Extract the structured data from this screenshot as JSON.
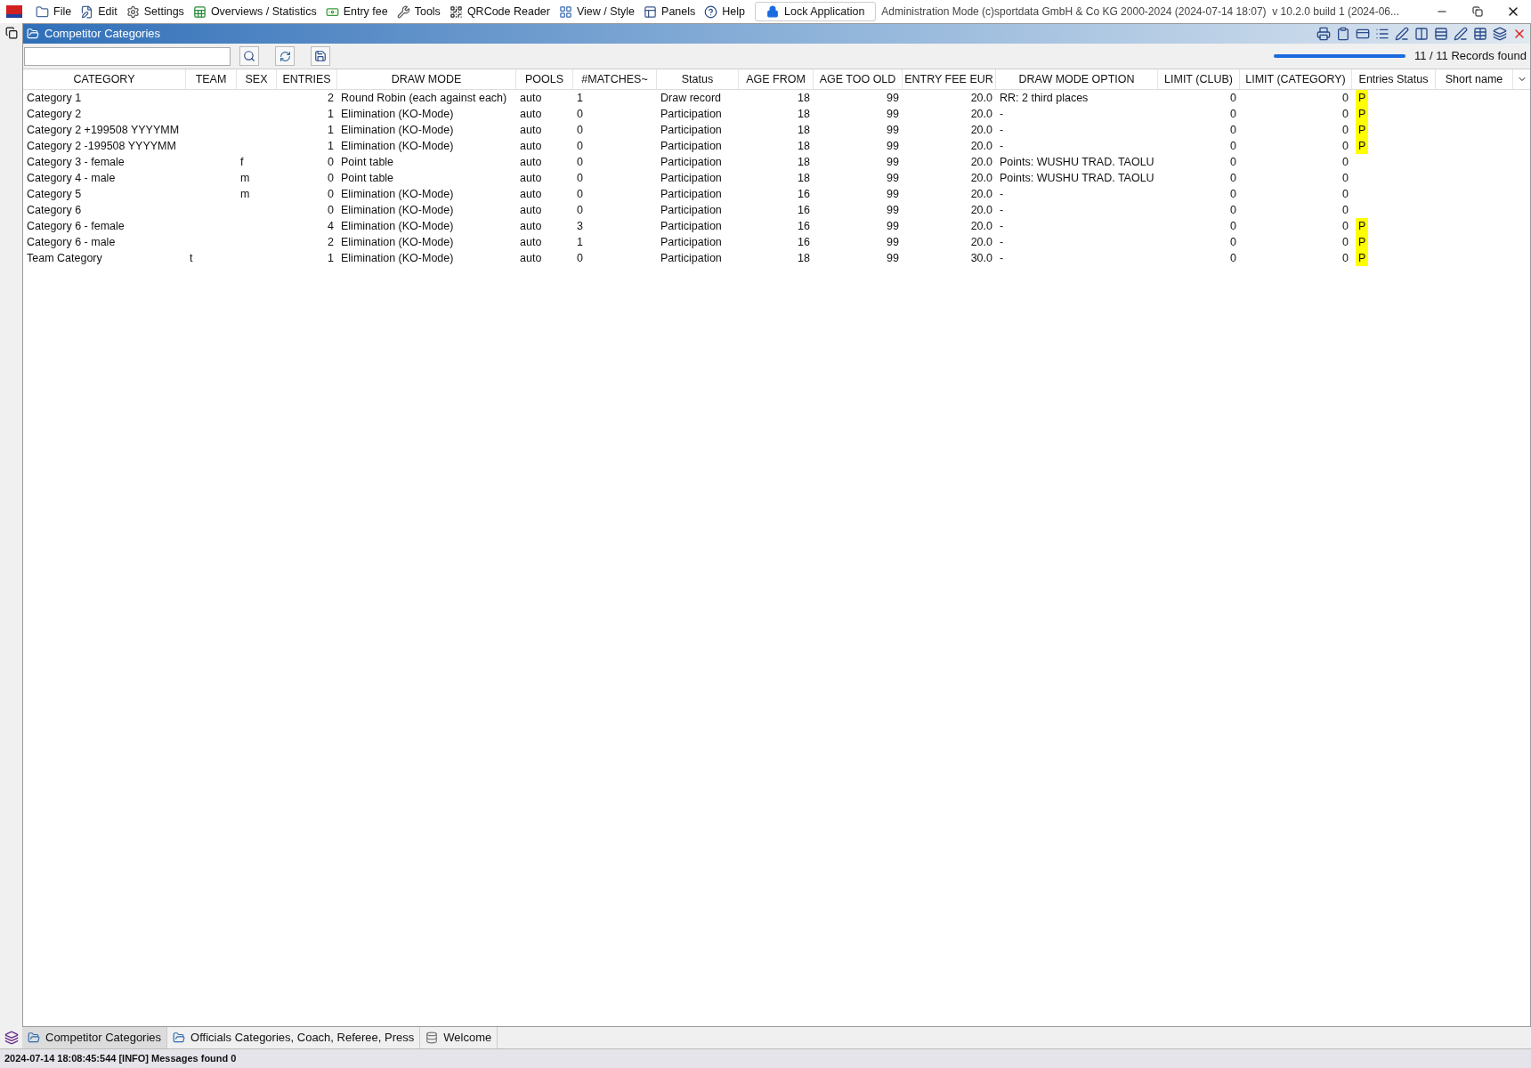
{
  "menu": {
    "items": [
      {
        "label": "File"
      },
      {
        "label": "Edit"
      },
      {
        "label": "Settings"
      },
      {
        "label": "Overviews / Statistics"
      },
      {
        "label": "Entry fee"
      },
      {
        "label": "Tools"
      },
      {
        "label": "QRCode Reader"
      },
      {
        "label": "View / Style"
      },
      {
        "label": "Panels"
      },
      {
        "label": "Help"
      }
    ],
    "lock_button": "Lock Application",
    "title_text": "Administration Mode (c)sportdata GmbH & Co KG 2000-2024 (2024-07-14 18:07)  v 10.2.0 build 1 (2024-06..."
  },
  "panel": {
    "title": "Competitor Categories",
    "progress": {
      "level": 1.0
    },
    "records_found": "11 / 11 Records found"
  },
  "table": {
    "columns": [
      "CATEGORY",
      "TEAM",
      "SEX",
      "ENTRIES",
      "DRAW MODE",
      "POOLS",
      "#MATCHES~",
      "Status",
      "AGE FROM",
      "AGE TOO OLD",
      "ENTRY FEE EUR",
      "DRAW MODE OPTION",
      "LIMIT (CLUB)",
      "LIMIT (CATEGORY)",
      "Entries Status",
      "Short name"
    ],
    "rows": [
      {
        "cells": [
          "Category 1",
          "",
          "",
          "2",
          "Round Robin (each against each)",
          "auto",
          "1",
          "Draw record",
          "18",
          "99",
          "20.0",
          "RR: 2 third places",
          "0",
          "0"
        ],
        "entries_status": "P"
      },
      {
        "cells": [
          "Category 2",
          "",
          "",
          "1",
          "Elimination (KO-Mode)",
          "auto",
          "0",
          "Participation",
          "18",
          "99",
          "20.0",
          "-",
          "0",
          "0"
        ],
        "entries_status": "P"
      },
      {
        "cells": [
          "Category 2 +199508 YYYYMM",
          "",
          "",
          "1",
          "Elimination (KO-Mode)",
          "auto",
          "0",
          "Participation",
          "18",
          "99",
          "20.0",
          "-",
          "0",
          "0"
        ],
        "entries_status": "P"
      },
      {
        "cells": [
          "Category 2 -199508 YYYYMM",
          "",
          "",
          "1",
          "Elimination (KO-Mode)",
          "auto",
          "0",
          "Participation",
          "18",
          "99",
          "20.0",
          "-",
          "0",
          "0"
        ],
        "entries_status": "P"
      },
      {
        "cells": [
          "Category 3 - female",
          "",
          "f",
          "0",
          "Point table",
          "auto",
          "0",
          "Participation",
          "18",
          "99",
          "20.0",
          "Points: WUSHU TRAD. TAOLU",
          "0",
          "0"
        ]
      },
      {
        "cells": [
          "Category 4 - male",
          "",
          "m",
          "0",
          "Point table",
          "auto",
          "0",
          "Participation",
          "18",
          "99",
          "20.0",
          "Points: WUSHU TRAD. TAOLU",
          "0",
          "0"
        ]
      },
      {
        "cells": [
          "Category 5",
          "",
          "m",
          "0",
          "Elimination (KO-Mode)",
          "auto",
          "0",
          "Participation",
          "16",
          "99",
          "20.0",
          "-",
          "0",
          "0"
        ]
      },
      {
        "cells": [
          "Category 6",
          "",
          "",
          "0",
          "Elimination (KO-Mode)",
          "auto",
          "0",
          "Participation",
          "16",
          "99",
          "20.0",
          "-",
          "0",
          "0"
        ]
      },
      {
        "cells": [
          "Category 6 - female",
          "",
          "",
          "4",
          "Elimination (KO-Mode)",
          "auto",
          "3",
          "Participation",
          "16",
          "99",
          "20.0",
          "-",
          "0",
          "0"
        ],
        "entries_status": "P"
      },
      {
        "cells": [
          "Category 6 - male",
          "",
          "",
          "2",
          "Elimination (KO-Mode)",
          "auto",
          "1",
          "Participation",
          "16",
          "99",
          "20.0",
          "-",
          "0",
          "0"
        ],
        "entries_status": "P"
      },
      {
        "cells": [
          "Team Category",
          "t",
          "",
          "1",
          "Elimination (KO-Mode)",
          "auto",
          "0",
          "Participation",
          "18",
          "99",
          "30.0",
          "-",
          "0",
          "0"
        ],
        "entries_status": "P"
      }
    ]
  },
  "bottom_tabs": [
    {
      "label": "Competitor Categories",
      "selected": true
    },
    {
      "label": "Officials Categories, Coach, Referee, Press",
      "selected": false
    },
    {
      "label": "Welcome",
      "selected": false
    }
  ],
  "status_bar": "2024-07-14 18:08:45:544 [INFO] Messages found 0"
}
